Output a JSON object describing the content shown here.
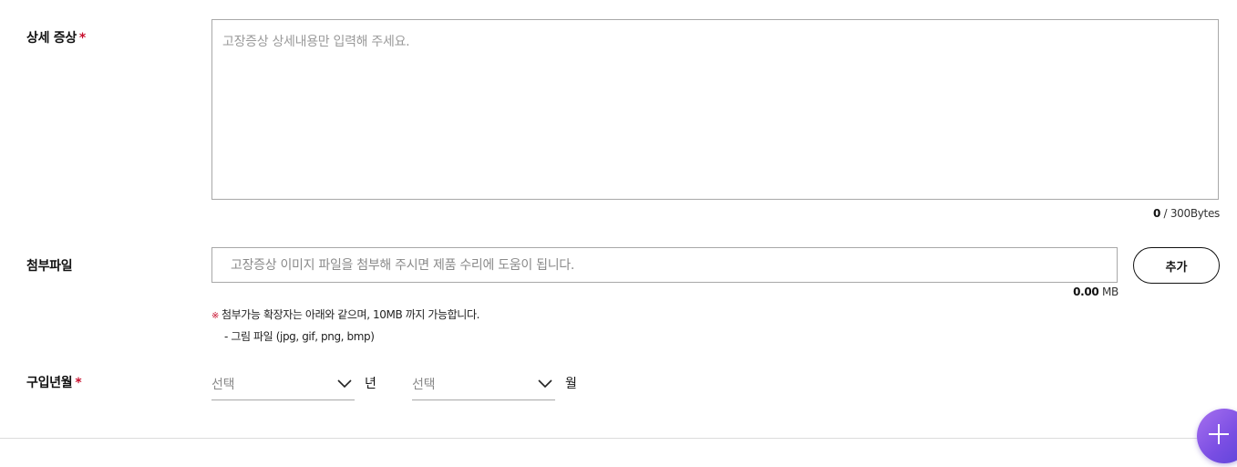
{
  "detail": {
    "label": "상세 증상",
    "required_mark": "*",
    "placeholder": "고장증상 상세내용만 입력해 주세요.",
    "value": "",
    "byte_count": "0",
    "byte_limit": " / 300Bytes"
  },
  "attachment": {
    "label": "첨부파일",
    "placeholder": "고장증상 이미지 파일을 첨부해 주시면 제품 수리에 도움이 됩니다.",
    "add_label": "추가",
    "size_value": "0.00",
    "size_unit": " MB",
    "note_mark": "※",
    "note_text": "첨부가능 확장자는 아래와 같으며, 10MB 까지 가능합니다.",
    "note_sub": "- 그림 파일 (jpg, gif, png, bmp)"
  },
  "purchase": {
    "label": "구입년월",
    "required_mark": "*",
    "year_select": "선택",
    "year_unit": "년",
    "month_select": "선택",
    "month_unit": "월"
  },
  "icons": {
    "select_arrow": "chevron-down-icon",
    "fab": "plus-icon"
  },
  "colors": {
    "required": "#c8102e",
    "fab_gradient_start": "#a770ef",
    "fab_gradient_end": "#5a43d8"
  }
}
